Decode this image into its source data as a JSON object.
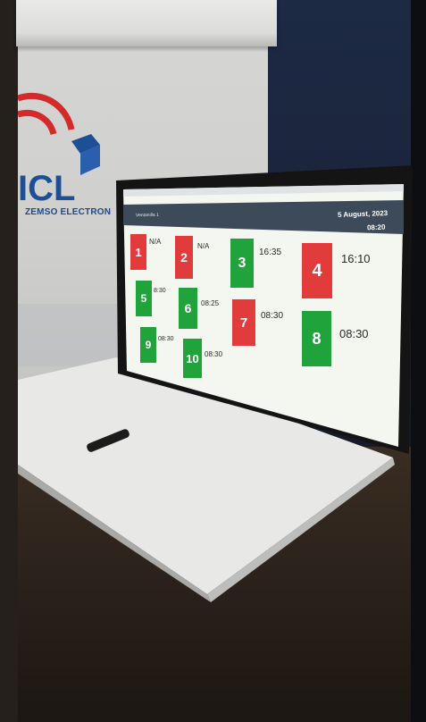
{
  "logo": {
    "name": "ZEMSO ELECTRON",
    "colors": {
      "red": "#d32a2a",
      "blue": "#1d4f96"
    }
  },
  "screen": {
    "header_title": "Ventanilla 1",
    "date": "5 August, 2023",
    "time": "08:20",
    "colors": {
      "header": "#3c4a59",
      "background": "#f4f6f0",
      "red": "#e23b3b",
      "green": "#21a33b"
    },
    "tickets": [
      {
        "number": "1",
        "time": "N/A",
        "status": "red"
      },
      {
        "number": "2",
        "time": "N/A",
        "status": "red"
      },
      {
        "number": "3",
        "time": "16:35",
        "status": "green"
      },
      {
        "number": "4",
        "time": "16:10",
        "status": "red"
      },
      {
        "number": "5",
        "time": "8:30",
        "status": "green"
      },
      {
        "number": "6",
        "time": "08:25",
        "status": "green"
      },
      {
        "number": "7",
        "time": "08:30",
        "status": "red"
      },
      {
        "number": "8",
        "time": "08:30",
        "status": "green"
      },
      {
        "number": "9",
        "time": "08:30",
        "status": "green"
      },
      {
        "number": "10",
        "time": "08:30",
        "status": "green"
      }
    ]
  }
}
